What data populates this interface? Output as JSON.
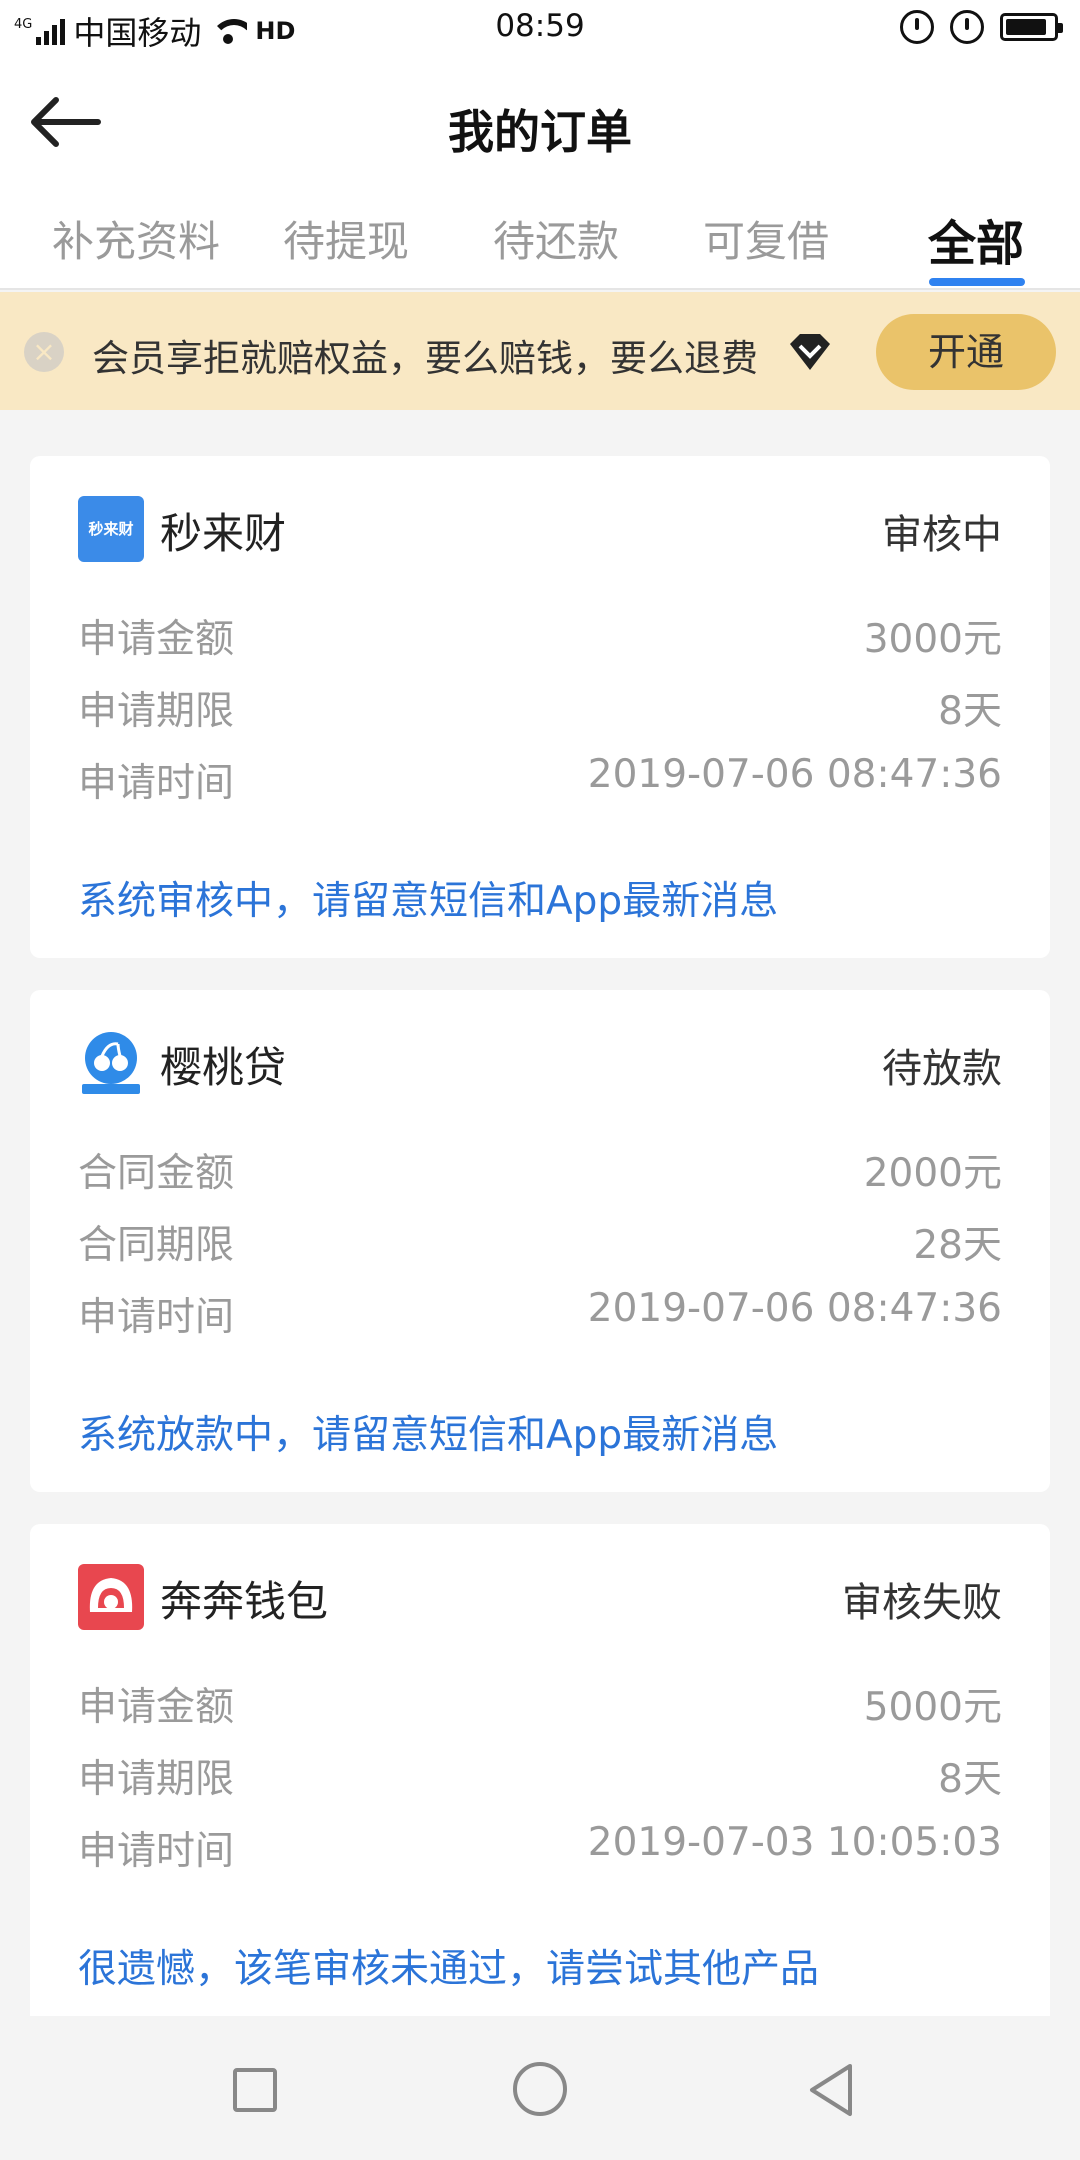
{
  "status_bar": {
    "network": "4G",
    "carrier": "中国移动",
    "call": "HD",
    "time": "08:59"
  },
  "header": {
    "title": "我的订单"
  },
  "tabs": [
    {
      "label": "补充资料",
      "active": false
    },
    {
      "label": "待提现",
      "active": false
    },
    {
      "label": "待还款",
      "active": false
    },
    {
      "label": "可复借",
      "active": false
    },
    {
      "label": "全部",
      "active": true
    }
  ],
  "banner": {
    "text": "会员享拒就赔权益，要么赔钱，要么退费",
    "button_label": "开通"
  },
  "orders": [
    {
      "logo_text": "秒来财",
      "name": "秒来财",
      "status": "审核中",
      "rows": [
        {
          "label": "申请金额",
          "value": "3000元"
        },
        {
          "label": "申请期限",
          "value": "8天"
        },
        {
          "label": "申请时间",
          "value": "2019-07-06 08:47:36"
        }
      ],
      "message": "系统审核中，请留意短信和App最新消息"
    },
    {
      "logo_text": "樱桃贷",
      "name": "樱桃贷",
      "status": "待放款",
      "rows": [
        {
          "label": "合同金额",
          "value": "2000元"
        },
        {
          "label": "合同期限",
          "value": "28天"
        },
        {
          "label": "申请时间",
          "value": "2019-07-06 08:47:36"
        }
      ],
      "message": "系统放款中，请留意短信和App最新消息"
    },
    {
      "name": "奔奔钱包",
      "status": "审核失败",
      "rows": [
        {
          "label": "申请金额",
          "value": "5000元"
        },
        {
          "label": "申请期限",
          "value": "8天"
        },
        {
          "label": "申请时间",
          "value": "2019-07-03 10:05:03"
        }
      ],
      "message": "很遗憾，该笔审核未通过，请尝试其他产品"
    }
  ],
  "colors": {
    "accent": "#2f82f0",
    "link": "#2b74d8",
    "banner_bg": "#f9e8c4",
    "banner_button": "#eac36a"
  }
}
